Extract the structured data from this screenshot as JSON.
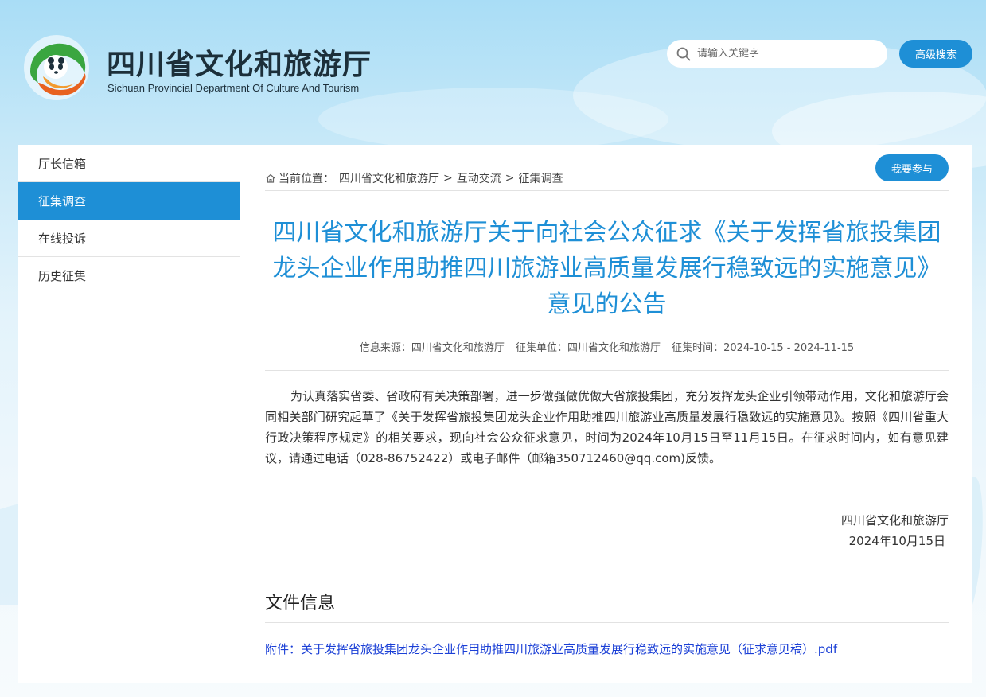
{
  "header": {
    "title_cn": "四川省文化和旅游厅",
    "title_en": "Sichuan Provincial Department Of Culture And Tourism",
    "search_placeholder": "请输入关键字",
    "advanced_search": "高级搜索"
  },
  "sidebar": {
    "items": [
      {
        "label": "厅长信箱"
      },
      {
        "label": "征集调查"
      },
      {
        "label": "在线投诉"
      },
      {
        "label": "历史征集"
      }
    ],
    "active_index": 1
  },
  "breadcrumb": {
    "prefix": "当前位置：",
    "items": [
      "四川省文化和旅游厅",
      "互动交流",
      "征集调查"
    ],
    "separator": ">"
  },
  "join_button": "我要参与",
  "article": {
    "title": "四川省文化和旅游厅关于向社会公众征求《关于发挥省旅投集团龙头企业作用助推四川旅游业高质量发展行稳致远的实施意见》意见的公告",
    "meta": {
      "source": "信息来源：四川省文化和旅游厅",
      "unit": "征集单位：四川省文化和旅游厅",
      "time": "征集时间：2024-10-15 - 2024-11-15"
    },
    "body": "为认真落实省委、省政府有关决策部署，进一步做强做优做大省旅投集团，充分发挥龙头企业引领带动作用，文化和旅游厅会同相关部门研究起草了《关于发挥省旅投集团龙头企业作用助推四川旅游业高质量发展行稳致远的实施意见》。按照《四川省重大行政决策程序规定》的相关要求，现向社会公众征求意见，时间为2024年10月15日至11月15日。在征求时间内，如有意见建议，请通过电话（028-86752422）或电子邮件（邮箱350712460@qq.com)反馈。",
    "signature": "四川省文化和旅游厅",
    "date": "2024年10月15日"
  },
  "files": {
    "heading": "文件信息",
    "attachment": "附件：关于发挥省旅投集团龙头企业作用助推四川旅游业高质量发展行稳致远的实施意见（征求意见稿）.pdf"
  },
  "colors": {
    "accent": "#1e8fd6",
    "link": "#1a3fd6",
    "title_dark": "#1c2f3a"
  },
  "icons": [
    "logo-emblem-icon",
    "search-icon",
    "home-icon"
  ]
}
